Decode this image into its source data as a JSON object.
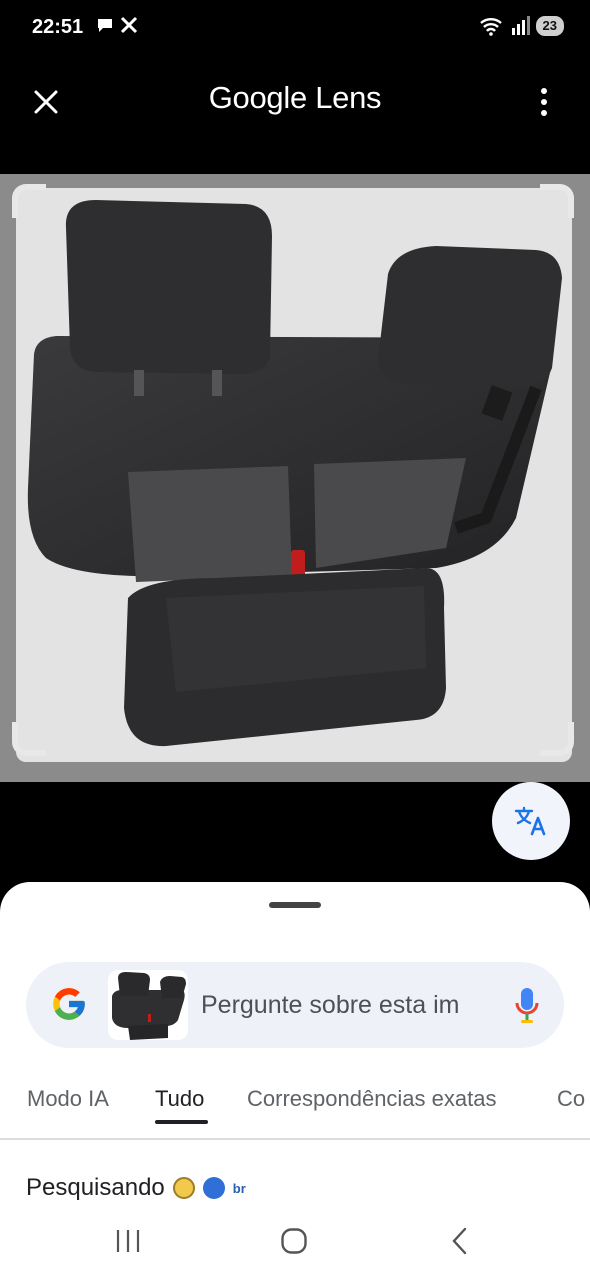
{
  "status_bar": {
    "time": "22:51",
    "battery": "23"
  },
  "app_bar": {
    "title_brand": "Google",
    "title_product": "Lens"
  },
  "image": {
    "alt": "Car rear bench seat with two headrests, dark gray fabric"
  },
  "search": {
    "placeholder": "Pergunte sobre esta im"
  },
  "tabs": [
    "Modo IA",
    "Tudo",
    "Correspondências exatas",
    "Co"
  ],
  "active_tab_index": 1,
  "searching_label": "Pesquisando",
  "searching_source_text": "br",
  "colors": {
    "accent_blue": "#1a73e8",
    "sheet_bg": "#ffffff",
    "pill_bg": "#eef1f7"
  }
}
